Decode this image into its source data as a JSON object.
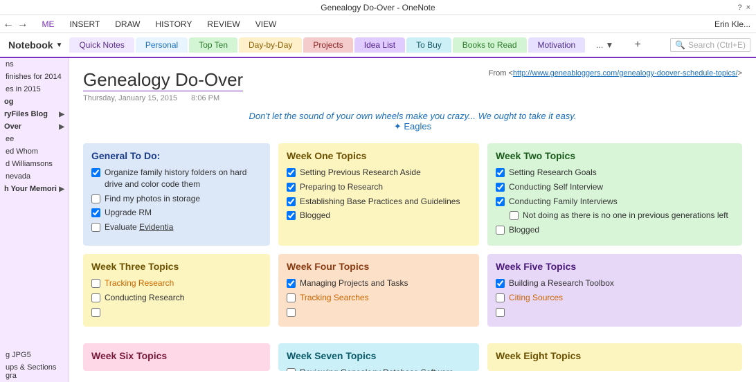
{
  "titleBar": {
    "title": "Genealogy Do-Over - OneNote",
    "helpLabel": "?",
    "closeLabel": "×"
  },
  "menuBar": {
    "backLabel": "←",
    "items": [
      "ME",
      "INSERT",
      "DRAW",
      "HISTORY",
      "REVIEW",
      "VIEW"
    ],
    "userName": "Erin Kle..."
  },
  "tabs": [
    {
      "id": "quick-notes",
      "label": "Quick Notes",
      "theme": "tab-quick-notes"
    },
    {
      "id": "personal",
      "label": "Personal",
      "theme": "tab-personal"
    },
    {
      "id": "top-ten",
      "label": "Top Ten",
      "theme": "tab-top-ten"
    },
    {
      "id": "day-by-day",
      "label": "Day-by-Day",
      "theme": "tab-day-by-day"
    },
    {
      "id": "projects",
      "label": "Projects",
      "theme": "tab-projects"
    },
    {
      "id": "idea-list",
      "label": "Idea List",
      "theme": "tab-idea-list"
    },
    {
      "id": "to-buy",
      "label": "To Buy",
      "theme": "tab-to-buy"
    },
    {
      "id": "books-to-read",
      "label": "Books to Read",
      "theme": "tab-books-to-read"
    },
    {
      "id": "motivation",
      "label": "Motivation",
      "theme": "tab-motivation"
    }
  ],
  "tabMore": "...",
  "tabAdd": "+",
  "notebookLabel": "Notebook",
  "searchPlaceholder": "Search (Ctrl+E)",
  "sidebar": {
    "items": [
      {
        "label": "ns"
      },
      {
        "label": "finishes for 2014"
      },
      {
        "label": "es in 2015"
      }
    ],
    "sections": [
      {
        "label": "og"
      },
      {
        "label": "ryFiles Blog",
        "hasArrow": true
      },
      {
        "label": "Over",
        "hasArrow": true
      }
    ],
    "subItems": [
      {
        "label": "ee"
      },
      {
        "label": "ed Whom"
      },
      {
        "label": "d Williamsons"
      },
      {
        "label": "nevada"
      },
      {
        "label": "h Your Memori",
        "hasArrow": true
      }
    ],
    "bottomItems": [
      {
        "label": "g JPG5"
      },
      {
        "label": "ups & Sections gra"
      }
    ]
  },
  "page": {
    "title": "Genealogy Do-Over",
    "date": "Thursday, January 15, 2015",
    "time": "8:06 PM",
    "sourcePrefix": "From <",
    "sourceUrl": "http://www.genealoggers.com/genealogy-doover-schedule-topics/",
    "sourceSuffix": ">",
    "quote": "Don't let the sound of your own wheels make you crazy... We ought to take it easy.",
    "quoteSongSymbol": "✦",
    "quoteSong": "Eagles"
  },
  "sections": {
    "generalToDo": {
      "title": "General To Do:",
      "theme": "theme-blue",
      "items": [
        {
          "checked": true,
          "text": "Organize family history folders on hard drive and color code them"
        },
        {
          "checked": false,
          "text": "Find my photos in storage"
        },
        {
          "checked": true,
          "text": "Upgrade RM"
        },
        {
          "checked": false,
          "text": "Evaluate Evidentia"
        }
      ]
    },
    "weekOne": {
      "title": "Week One Topics",
      "theme": "theme-yellow",
      "items": [
        {
          "checked": true,
          "text": "Setting Previous Research Aside"
        },
        {
          "checked": true,
          "text": "Preparing to Research"
        },
        {
          "checked": true,
          "text": "Establishing Base Practices and Guidelines"
        },
        {
          "checked": true,
          "text": "Blogged"
        }
      ]
    },
    "weekTwo": {
      "title": "Week Two Topics",
      "theme": "theme-green",
      "items": [
        {
          "checked": true,
          "text": "Setting Research Goals"
        },
        {
          "checked": true,
          "text": "Conducting Self Interview"
        },
        {
          "checked": true,
          "text": "Conducting Family Interviews"
        },
        {
          "checked": false,
          "text": "Not doing as there is no one in previous generations left",
          "subIndent": true
        },
        {
          "checked": false,
          "text": "Blogged"
        }
      ]
    },
    "weekThree": {
      "title": "Week Three Topics",
      "theme": "theme-yellow",
      "items": [
        {
          "checked": false,
          "text": "Tracking Research",
          "orange": true
        },
        {
          "checked": false,
          "text": "Conducting Research"
        },
        {
          "checked": false,
          "text": ""
        }
      ]
    },
    "weekFour": {
      "title": "Week Four Topics",
      "theme": "theme-peach",
      "items": [
        {
          "checked": true,
          "text": "Managing Projects and Tasks"
        },
        {
          "checked": false,
          "text": "Tracking Searches",
          "orange": true
        },
        {
          "checked": false,
          "text": ""
        }
      ]
    },
    "weekFive": {
      "title": "Week Five Topics",
      "theme": "theme-purple",
      "items": [
        {
          "checked": true,
          "text": "Building a Research Toolbox"
        },
        {
          "checked": false,
          "text": "Citing Sources",
          "orange": true
        },
        {
          "checked": false,
          "text": ""
        }
      ]
    },
    "weekSix": {
      "title": "Week Six Topics",
      "theme": "theme-pink",
      "items": []
    },
    "weekSeven": {
      "title": "Week Seven Topics",
      "theme": "theme-cyan",
      "items": [
        {
          "checked": false,
          "text": "Reviewing Genealogy Database Software"
        }
      ]
    },
    "weekEight": {
      "title": "Week Eight Topics",
      "theme": "theme-yellow",
      "items": []
    }
  }
}
